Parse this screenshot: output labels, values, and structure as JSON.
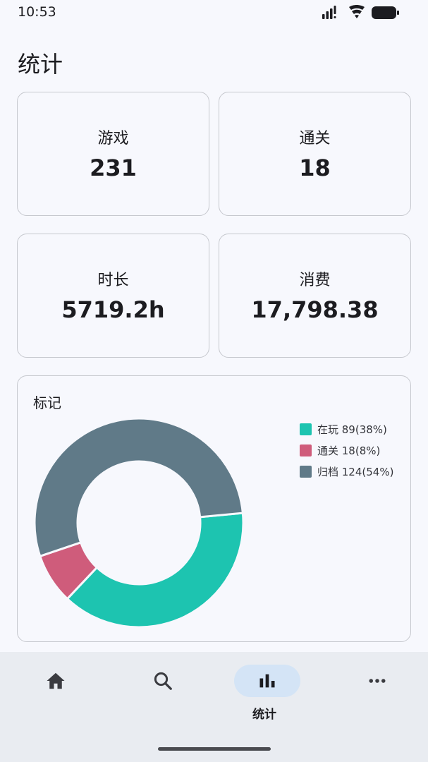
{
  "status_bar": {
    "time": "10:53",
    "icons": [
      "signal-icon",
      "wifi-icon",
      "battery-icon"
    ]
  },
  "page": {
    "title": "统计"
  },
  "stats": {
    "games": {
      "label": "游戏",
      "value": "231"
    },
    "cleared": {
      "label": "通关",
      "value": "18"
    },
    "duration": {
      "label": "时长",
      "value": "5719.2h"
    },
    "spending": {
      "label": "消费",
      "value": "17,798.38"
    }
  },
  "marks_chart": {
    "title": "标记",
    "legend": [
      {
        "label": "在玩 89(38%)",
        "color": "#1dc4b0"
      },
      {
        "label": "通关 18(8%)",
        "color": "#cf5c7b"
      },
      {
        "label": "归档 124(54%)",
        "color": "#607a88"
      }
    ]
  },
  "chart_data": {
    "type": "pie",
    "title": "标记",
    "categories": [
      "在玩",
      "通关",
      "归档"
    ],
    "values": [
      89,
      18,
      124
    ],
    "percentages": [
      38,
      8,
      54
    ],
    "colors": [
      "#1dc4b0",
      "#cf5c7b",
      "#607a88"
    ],
    "donut": true,
    "legend_position": "right"
  },
  "bottom_nav": {
    "items": [
      {
        "name": "home",
        "icon": "home-icon",
        "label": ""
      },
      {
        "name": "search",
        "icon": "search-icon",
        "label": ""
      },
      {
        "name": "stats",
        "icon": "bar-chart-icon",
        "label": "统计",
        "active": true
      },
      {
        "name": "more",
        "icon": "more-horizontal-icon",
        "label": ""
      }
    ]
  }
}
